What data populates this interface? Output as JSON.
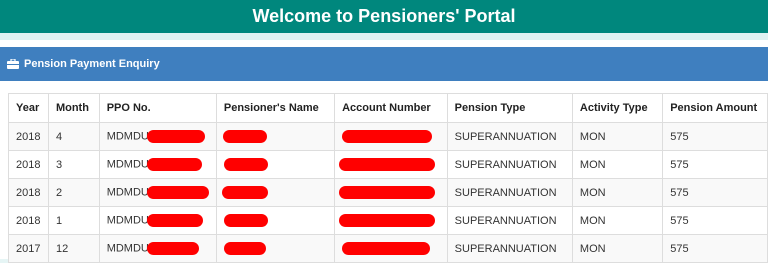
{
  "header": {
    "title": "Welcome to Pensioners' Portal"
  },
  "panel": {
    "title": "Pension Payment Enquiry",
    "icon": "briefcase-icon"
  },
  "table": {
    "columns": [
      "Year",
      "Month",
      "PPO No.",
      "Pensioner's Name",
      "Account Number",
      "Pension Type",
      "Activity Type",
      "Pension Amount"
    ],
    "rows": [
      {
        "year": "2018",
        "month": "4",
        "ppo_prefix": "MDMDU",
        "pension_type": "SUPERANNUATION",
        "activity_type": "MON",
        "amount": "575"
      },
      {
        "year": "2018",
        "month": "3",
        "ppo_prefix": "MDMDU",
        "pension_type": "SUPERANNUATION",
        "activity_type": "MON",
        "amount": "575"
      },
      {
        "year": "2018",
        "month": "2",
        "ppo_prefix": "MDMDU",
        "pension_type": "SUPERANNUATION",
        "activity_type": "MON",
        "amount": "575"
      },
      {
        "year": "2018",
        "month": "1",
        "ppo_prefix": "MDMDU",
        "pension_type": "SUPERANNUATION",
        "activity_type": "MON",
        "amount": "575"
      },
      {
        "year": "2017",
        "month": "12",
        "ppo_prefix": "MDMDU",
        "pension_type": "SUPERANNUATION",
        "activity_type": "MON",
        "amount": "575"
      }
    ]
  },
  "colors": {
    "header_bg": "#00877d",
    "panel_heading_bg": "#3f7fbf",
    "redaction": "#ff0000"
  }
}
